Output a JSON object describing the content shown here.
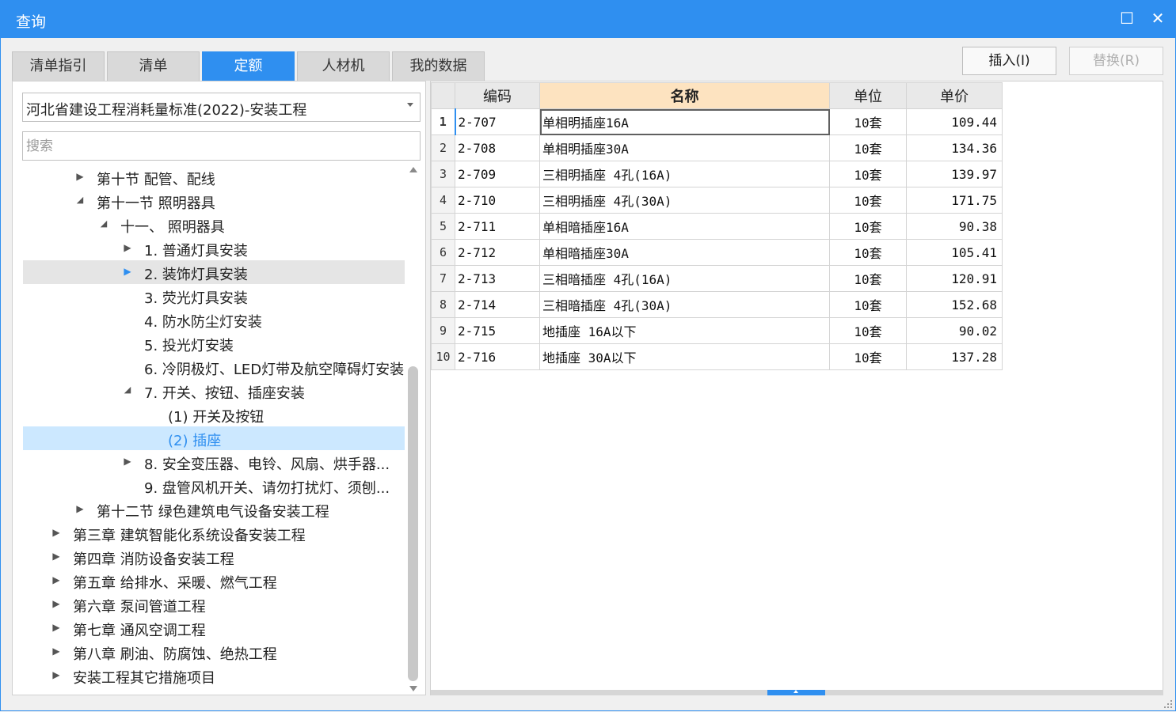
{
  "window": {
    "title": "查询",
    "maximize_glyph": "☐",
    "close_glyph": "✕"
  },
  "tabs": [
    {
      "label": "清单指引",
      "active": false
    },
    {
      "label": "清单",
      "active": false
    },
    {
      "label": "定额",
      "active": true
    },
    {
      "label": "人材机",
      "active": false
    },
    {
      "label": "我的数据",
      "active": false
    }
  ],
  "actions": {
    "insert_label": "插入(I)",
    "replace_label": "替换(R)"
  },
  "library": {
    "selected": "河北省建设工程消耗量标准(2022)-安装工程"
  },
  "search": {
    "placeholder": "搜索",
    "value": ""
  },
  "tree": [
    {
      "label": "第十节 配管、配线",
      "state": "collapsed"
    },
    {
      "label": "第十一节 照明器具",
      "state": "expanded"
    },
    {
      "label": "十一、 照明器具",
      "state": "expanded"
    },
    {
      "label": "1. 普通灯具安装",
      "state": "collapsed"
    },
    {
      "label": "2. 装饰灯具安装",
      "state": "collapsed",
      "hover": true
    },
    {
      "label": "3. 荧光灯具安装",
      "state": "leaf"
    },
    {
      "label": "4. 防水防尘灯安装",
      "state": "leaf"
    },
    {
      "label": "5. 投光灯安装",
      "state": "leaf"
    },
    {
      "label": "6. 冷阴极灯、LED灯带及航空障碍灯安装",
      "state": "leaf"
    },
    {
      "label": "7. 开关、按钮、插座安装",
      "state": "expanded"
    },
    {
      "label": "(1) 开关及按钮",
      "state": "leaf"
    },
    {
      "label": "(2) 插座",
      "state": "leaf",
      "selected": true
    },
    {
      "label": "8. 安全变压器、电铃、风扇、烘手器...",
      "state": "collapsed"
    },
    {
      "label": "9. 盘管风机开关、请勿打扰灯、须刨...",
      "state": "leaf"
    },
    {
      "label": "第十二节 绿色建筑电气设备安装工程",
      "state": "collapsed"
    },
    {
      "label": "第三章 建筑智能化系统设备安装工程",
      "state": "collapsed"
    },
    {
      "label": "第四章 消防设备安装工程",
      "state": "collapsed"
    },
    {
      "label": "第五章 给排水、采暖、燃气工程",
      "state": "collapsed"
    },
    {
      "label": "第六章 泵间管道工程",
      "state": "collapsed"
    },
    {
      "label": "第七章 通风空调工程",
      "state": "collapsed"
    },
    {
      "label": "第八章 刷油、防腐蚀、绝热工程",
      "state": "collapsed"
    },
    {
      "label": "安装工程其它措施项目",
      "state": "collapsed"
    }
  ],
  "grid": {
    "headers": {
      "code": "编码",
      "name": "名称",
      "unit": "单位",
      "price": "单价"
    },
    "rows": [
      {
        "idx": "1",
        "code": "2-707",
        "name": "单相明插座16A",
        "unit": "10套",
        "price": "109.44"
      },
      {
        "idx": "2",
        "code": "2-708",
        "name": "单相明插座30A",
        "unit": "10套",
        "price": "134.36"
      },
      {
        "idx": "3",
        "code": "2-709",
        "name": "三相明插座 4孔(16A)",
        "unit": "10套",
        "price": "139.97"
      },
      {
        "idx": "4",
        "code": "2-710",
        "name": "三相明插座 4孔(30A)",
        "unit": "10套",
        "price": "171.75"
      },
      {
        "idx": "5",
        "code": "2-711",
        "name": "单相暗插座16A",
        "unit": "10套",
        "price": "90.38"
      },
      {
        "idx": "6",
        "code": "2-712",
        "name": "单相暗插座30A",
        "unit": "10套",
        "price": "105.41"
      },
      {
        "idx": "7",
        "code": "2-713",
        "name": "三相暗插座 4孔(16A)",
        "unit": "10套",
        "price": "120.91"
      },
      {
        "idx": "8",
        "code": "2-714",
        "name": "三相暗插座 4孔(30A)",
        "unit": "10套",
        "price": "152.68"
      },
      {
        "idx": "9",
        "code": "2-715",
        "name": "地插座 16A以下",
        "unit": "10套",
        "price": "90.02"
      },
      {
        "idx": "10",
        "code": "2-716",
        "name": "地插座 30A以下",
        "unit": "10套",
        "price": "137.28"
      }
    ]
  }
}
